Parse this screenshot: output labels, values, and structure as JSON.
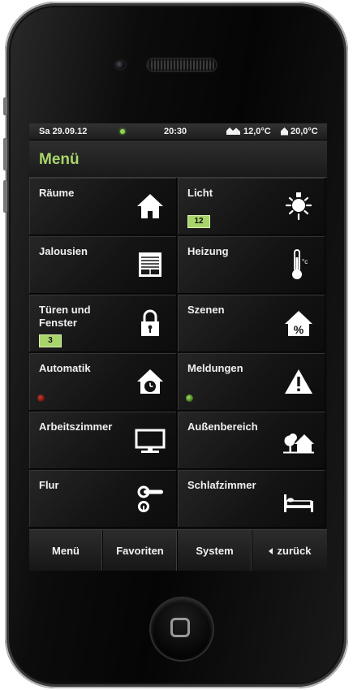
{
  "status": {
    "date": "Sa 29.09.12",
    "time": "20:30",
    "outdoor_temp": "12,0°C",
    "indoor_temp": "20,0°C",
    "online_dot_color": "#8dd64f"
  },
  "header": {
    "title": "Menü",
    "title_color": "#a9d46b"
  },
  "tiles": [
    {
      "label": "Räume",
      "icon": "house-icon"
    },
    {
      "label": "Licht",
      "icon": "light-bulb-icon",
      "badge": "12"
    },
    {
      "label": "Jalousien",
      "icon": "blinds-icon"
    },
    {
      "label": "Heizung",
      "icon": "thermometer-icon"
    },
    {
      "label": "Türen und Fenster",
      "icon": "padlock-icon",
      "badge": "3"
    },
    {
      "label": "Szenen",
      "icon": "house-percent-icon"
    },
    {
      "label": "Automatik",
      "icon": "house-clock-icon",
      "led": "red"
    },
    {
      "label": "Meldungen",
      "icon": "warning-icon",
      "led": "green"
    },
    {
      "label": "Arbeitszimmer",
      "icon": "monitor-icon"
    },
    {
      "label": "Außenbereich",
      "icon": "tree-house-icon"
    },
    {
      "label": "Flur",
      "icon": "door-handle-icon"
    },
    {
      "label": "Schlafzimmer",
      "icon": "bed-icon"
    }
  ],
  "tabs": [
    {
      "label": "Menü"
    },
    {
      "label": "Favoriten"
    },
    {
      "label": "System"
    },
    {
      "label": "zurück",
      "icon": "back-arrow-icon"
    }
  ]
}
